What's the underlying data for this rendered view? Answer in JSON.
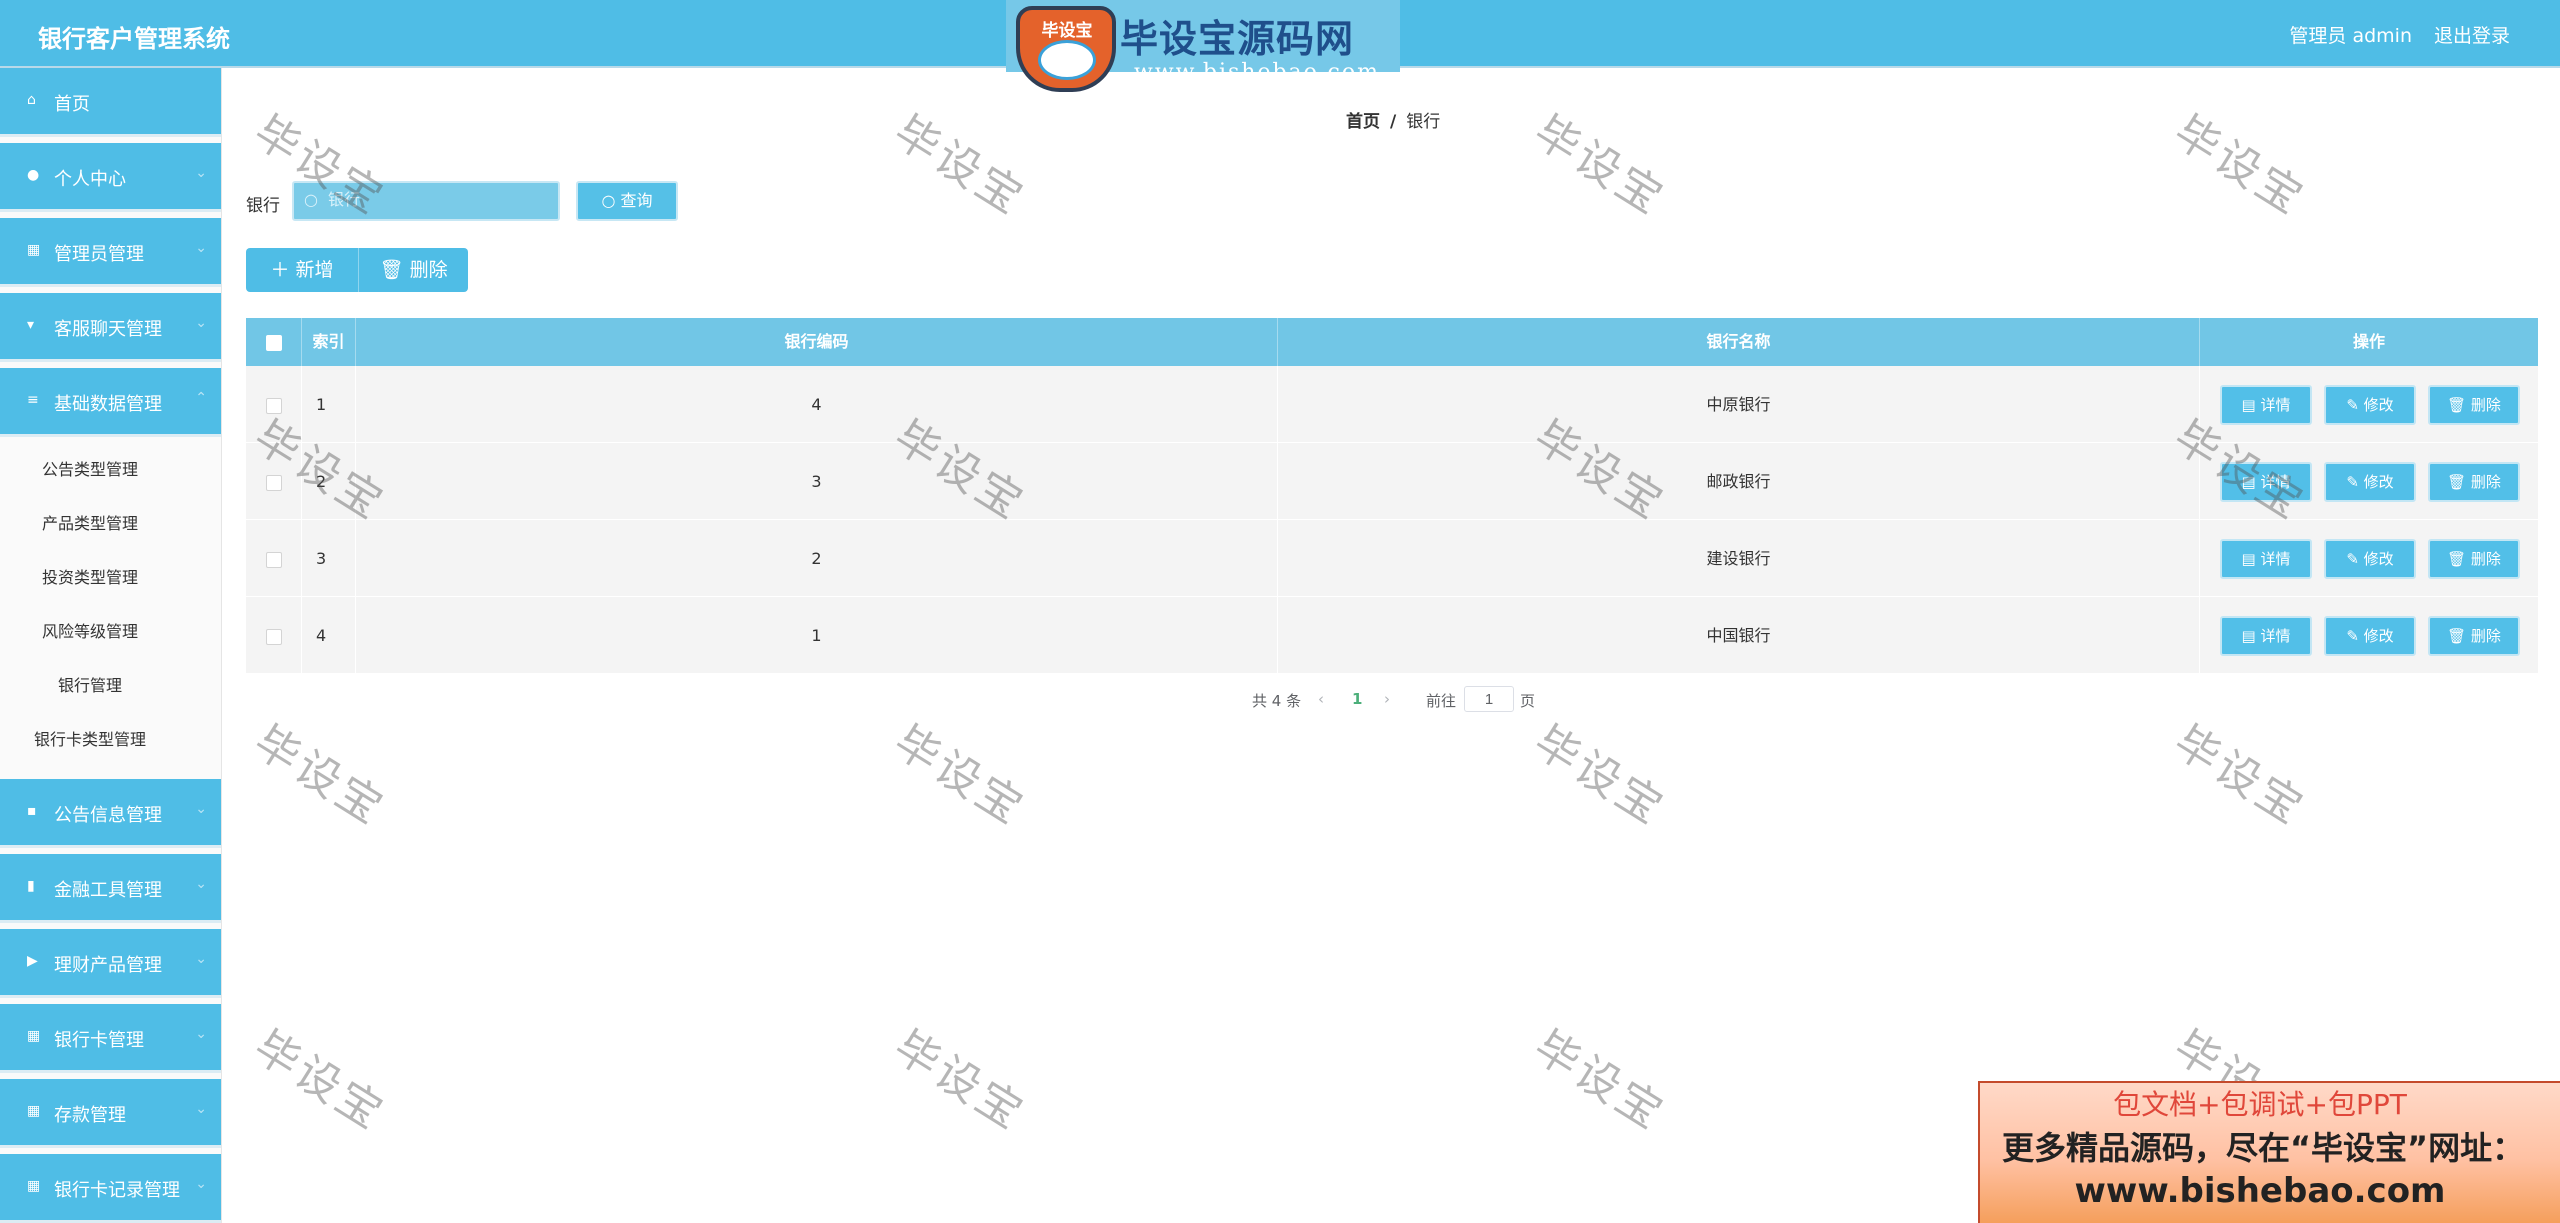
{
  "header": {
    "app_title": "银行客户管理系统",
    "user_label": "管理员 admin",
    "logout_label": "退出登录"
  },
  "logo": {
    "seal_text": "毕设宝",
    "name": "毕设宝源码网",
    "url": "www.bishebao.com"
  },
  "sidebar": {
    "items": [
      {
        "label": "首页",
        "icon": "home-icon",
        "glyph": "⌂"
      },
      {
        "label": "个人中心",
        "icon": "user-icon",
        "glyph": "●"
      },
      {
        "label": "管理员管理",
        "icon": "grid-icon",
        "glyph": "▦"
      },
      {
        "label": "客服聊天管理",
        "icon": "chat-icon",
        "glyph": "▾"
      },
      {
        "label": "基础数据管理",
        "icon": "list-icon",
        "glyph": "≡"
      }
    ],
    "sub_items": [
      "公告类型管理",
      "产品类型管理",
      "投资类型管理",
      "风险等级管理",
      "银行管理",
      "银行卡类型管理"
    ],
    "items_after": [
      {
        "label": "公告信息管理",
        "icon": "message-icon",
        "glyph": "▪"
      },
      {
        "label": "金融工具管理",
        "icon": "bar-chart-icon",
        "glyph": "▮"
      },
      {
        "label": "理财产品管理",
        "icon": "flag-icon",
        "glyph": "▶"
      },
      {
        "label": "银行卡管理",
        "icon": "grid-icon",
        "glyph": "▦"
      },
      {
        "label": "存款管理",
        "icon": "grid-icon",
        "glyph": "▦"
      },
      {
        "label": "银行卡记录管理",
        "icon": "grid-icon",
        "glyph": "▦"
      }
    ]
  },
  "breadcrumb": {
    "home": "首页",
    "separator": "/",
    "current": "银行"
  },
  "search": {
    "label": "银行",
    "placeholder": "银行",
    "button_label": "查询"
  },
  "toolbar": {
    "add_label": "新增",
    "delete_label": "删除"
  },
  "table": {
    "columns": [
      "索引",
      "银行编码",
      "银行名称",
      "操作"
    ],
    "rows": [
      {
        "index": "1",
        "code": "4",
        "name": "中原银行"
      },
      {
        "index": "2",
        "code": "3",
        "name": "邮政银行"
      },
      {
        "index": "3",
        "code": "2",
        "name": "建设银行"
      },
      {
        "index": "4",
        "code": "1",
        "name": "中国银行"
      }
    ],
    "ops": {
      "detail": "详情",
      "edit": "修改",
      "delete": "删除"
    }
  },
  "pagination": {
    "total": "共 4 条",
    "current_page": "1",
    "goto_prefix": "前往",
    "goto_value": "1",
    "goto_suffix": "页"
  },
  "watermark_text": "毕设宝",
  "ad": {
    "line1": "包文档+包调试+包PPT",
    "line2": "更多精品源码，尽在“毕设宝”网址：",
    "line3": "www.bishebao.com"
  },
  "colors": {
    "primary": "#4fbde6",
    "header_row": "#71c6e6",
    "row_bg": "#f4f4f4",
    "page_active": "#4caf7a"
  }
}
